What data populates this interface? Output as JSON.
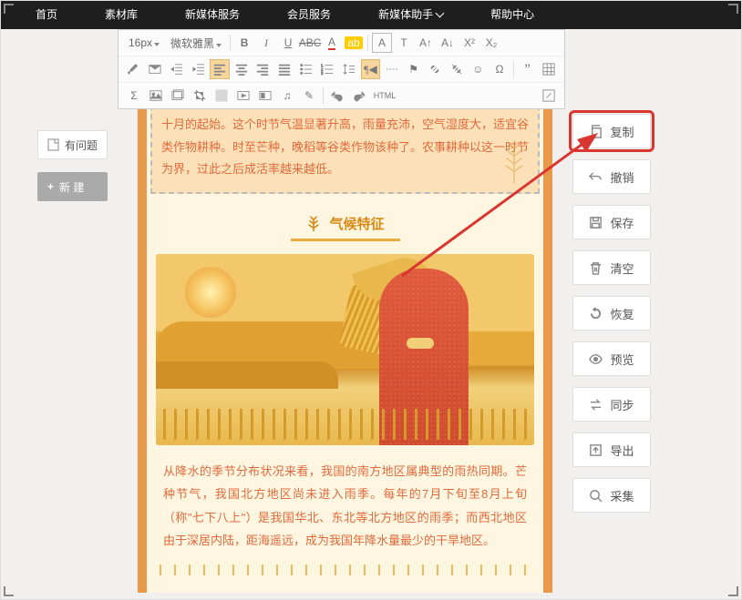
{
  "nav": [
    "首页",
    "素材库",
    "新媒体服务",
    "会员服务",
    "新媒体助手",
    "帮助中心"
  ],
  "nav_has_dropdown_idx": 4,
  "toolbar": {
    "font_size": "16px",
    "font_family": "微软雅黑",
    "html_btn": "HTML"
  },
  "left": {
    "btn1": "有问题",
    "btn2": "新 建"
  },
  "sidebar": [
    {
      "key": "copy",
      "label": "复制",
      "hl": true
    },
    {
      "key": "undo",
      "label": "撤销"
    },
    {
      "key": "save",
      "label": "保存"
    },
    {
      "key": "clear",
      "label": "清空"
    },
    {
      "key": "restore",
      "label": "恢复"
    },
    {
      "key": "preview",
      "label": "预览"
    },
    {
      "key": "sync",
      "label": "同步"
    },
    {
      "key": "export",
      "label": "导出"
    },
    {
      "key": "collect",
      "label": "采集"
    }
  ],
  "content": {
    "selected_text": "十月的起始。这个时节气温显著升高，雨量充沛，空气湿度大，适宜谷类作物耕种。时至芒种，晚稻等谷类作物该种了。农事耕种以这一时节为界，过此之后成活率越来越低。",
    "section_title": "气候特征",
    "paragraph": "从降水的季节分布状况来看，我国的南方地区属典型的雨热同期。芒种节气，我国北方地区尚未进入雨季。每年的7月下旬至8月上旬（称\"七下八上\"）是我国华北、东北等北方地区的雨季；而西北地区由于深居内陆，距海遥远，成为我国年降水量最少的干旱地区。"
  }
}
